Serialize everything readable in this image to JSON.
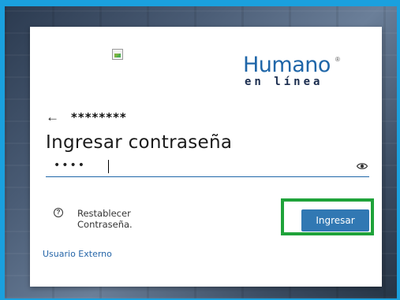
{
  "login": {
    "broken_image_icon": "broken-image-icon",
    "logo": {
      "brand": "Humano",
      "registered": "®",
      "tagline": "en línea"
    },
    "back_icon": "←",
    "username_masked": "********",
    "title": "Ingresar contraseña",
    "password_value": "••••",
    "eye_icon": "eye-icon",
    "help_icon": "?",
    "reset_label_line1": "Restablecer",
    "reset_label_line2": "Contraseña.",
    "submit_label": "Ingresar",
    "external_user_link": "Usuario Externo"
  },
  "colors": {
    "accent": "#1f66a8",
    "button": "#3178b3",
    "highlight": "#1fa33a",
    "frame": "#1aa0de"
  }
}
